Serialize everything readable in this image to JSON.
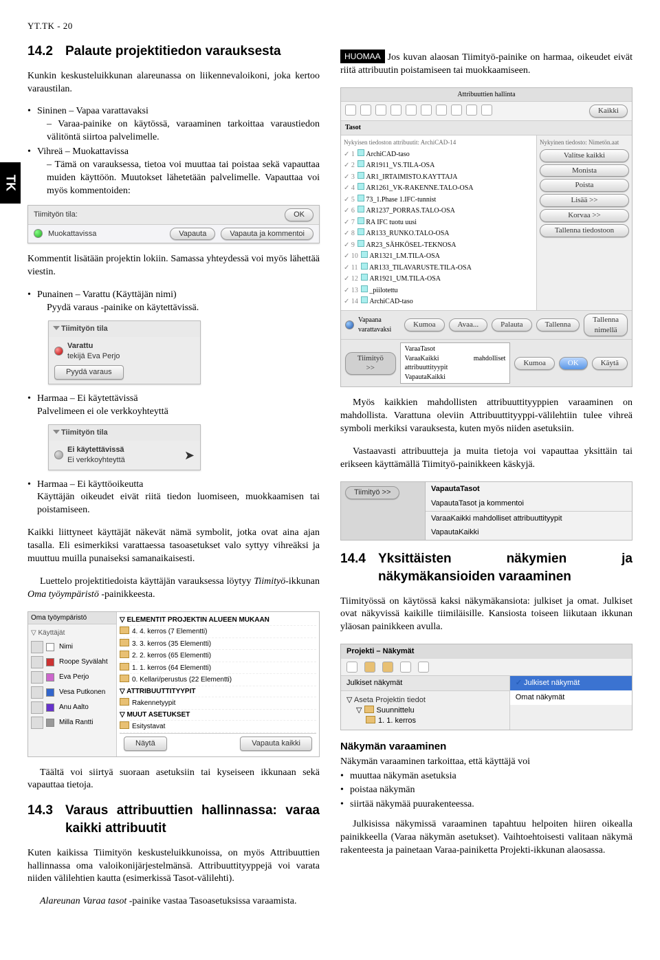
{
  "header": "YT.TK - 20",
  "side_tab": "TK",
  "s14_2": {
    "num": "14.2",
    "title": "Palaute projektitiedon varauksesta",
    "intro": "Kunkin keskusteluikkunan alareunassa on liikennevaloikoni, joka kertoo varaustilan.",
    "blue_t": "Sininen – Vapaa varattavaksi",
    "blue_d": "– Varaa-painike on käytössä, varaaminen tarkoittaa varaustiedon välitöntä siirtoa palvelimelle.",
    "green_t": "Vihreä – Muokattavissa",
    "green_d": "– Tämä on varauksessa, tietoa voi muuttaa tai poistaa sekä vapauttaa muiden käyttöön. Muutokset lähetetään palvelimelle. Vapauttaa voi myös kommentoiden:"
  },
  "shot1": {
    "label": "Tiimityön tila:",
    "status": "Muokattavissa",
    "ok": "OK",
    "rel": "Vapauta",
    "relc": "Vapauta ja kommentoi"
  },
  "after1": "Kommentit lisätään projektin lokiin. Samassa yhteydessä voi myös lähettää viestin.",
  "red_t": "Punainen – Varattu (Käyttäjän nimi)",
  "red_d": "Pyydä varaus -painike on käytettävissä.",
  "shot2": {
    "title": "Tiimityön tila",
    "l1": "Varattu",
    "l2": "tekijä Eva Perjo",
    "btn": "Pyydä varaus"
  },
  "grey1_t": "Harmaa – Ei käytettävissä",
  "grey1_d": "Palvelimeen ei ole verkkoyhteyttä",
  "shot3": {
    "title": "Tiimityön tila",
    "l1": "Ei käytettävissä",
    "l2": "Ei verkkoyhteyttä"
  },
  "grey2_t": "Harmaa – Ei käyttöoikeutta",
  "grey2_d": "Käyttäjän oikeudet eivät riitä tiedon luomiseen, muokkaamisen tai poistamiseen.",
  "p_sym": "Kaikki liittyneet käyttäjät näkevät nämä symbolit, jotka ovat aina ajan tasalla. Eli esimerkiksi varattaessa tasoasetukset valo syttyy vihreäksi ja muuttuu muilla punaiseksi samanaikaisesti.",
  "p_luettelo1": "Luettelo projektitiedoista käyttäjän varauksessa löytyy ",
  "p_luettelo_it1": "Tiimityö",
  "p_luettelo2": "-ikkunan ",
  "p_luettelo_it2": "Oma työympäristö",
  "p_luettelo3": " -painikkeesta.",
  "tree": {
    "head": "Oma työympäristö",
    "users_h": "Käyttäjät",
    "u": [
      "Nimi",
      "Roope Syvälaht",
      "Eva Perjo",
      "Vesa Putkonen",
      "Anu Aalto",
      "Milla Rantti"
    ],
    "th": "ELEMENTIT PROJEKTIN ALUEEN MUKAAN",
    "rows": [
      "4. 4. kerros (7 Elementti)",
      "3. 3. kerros (35 Elementti)",
      "2. 2. kerros (65 Elementti)",
      "1. 1. kerros (64 Elementti)",
      "0. Kellari/perustus (22 Elementti)"
    ],
    "th2": "ATTRIBUUTTITYYPIT",
    "r2": "Rakennetyypit",
    "th3": "MUUT ASETUKSET",
    "r3": "Esitystavat",
    "btn_l": "Näytä",
    "btn_r": "Vapauta kaikki"
  },
  "p_taalta": "Täältä voi siirtyä suoraan asetuksiin tai kyseiseen ikkunaan sekä vapauttaa tietoja.",
  "s14_3": {
    "num": "14.3",
    "title": "Varaus attribuuttien hallinnassa: varaa kaikki attribuutit",
    "p1": "Kuten kaikissa Tiimityön keskusteluikkunoissa, on myös Attribuuttien hallinnassa oma valoikonijärjestelmänsä. Attribuuttityyppejä voi varata niiden välilehtien kautta (esimerkissä Tasot-välilehti).",
    "p2a": "Alareunan Varaa tasot",
    "p2b": " -painike vastaa Tasoasetuksissa varaamista."
  },
  "right": {
    "note_label": "HUOMAA",
    "note": "Jos kuvan alaosan Tiimityö-painike on harmaa, oikeudet eivät riitä attribuutin poistamiseen tai muokkaamiseen.",
    "attr": {
      "title": "Attribuuttien hallinta",
      "tab": "Tasot",
      "left_h": "Nykyisen tiedoston attribuutit: ArchiCAD-14",
      "right_h": "Nykyinen tiedosto: Nimetön.aat",
      "rows": [
        "ArchiCAD-taso",
        "AR1911_VS.TILA-OSA",
        "AR1_IRTAIMISTO.KAYTTAJA",
        "AR1261_VK-RAKENNE.TALO-OSA",
        "73_1.Phase 1.IFC-tunnist",
        "AR1237_PORRAS.TALO-OSA",
        "RA IFC tuotu uusi",
        "AR133_RUNKO.TALO-OSA",
        "AR23_SÄHKÖSEL-TEKNOSA",
        "AR1321_LM.TILA-OSA",
        "AR133_TILAVARUSTE.TILA-OSA",
        "AR1921_UM.TILA-OSA",
        "_piilotettu",
        "ArchiCAD-taso"
      ],
      "btns": [
        "Valitse kaikki",
        "Monista",
        "Poista",
        "Lisää >>",
        "Korvaa >>",
        "Tallenna tiedostoon"
      ],
      "foot_left": "Vapaana varattavaksi",
      "btns2": [
        "Kumoa",
        "Avaa...",
        "Palauta",
        "Tallenna",
        "Tallenna nimellä"
      ],
      "team": "Tiimityö >>",
      "menu": [
        "VaraaTasot",
        "VaraaKaikki mahdolliset attribuuttityypit",
        "VapautaKaikki"
      ],
      "ok": "OK",
      "cancel": "Kumoa",
      "apply": "Käytä"
    },
    "p_myos": "Myös kaikkien mahdollisten attribuuttityyppien varaaminen on mahdollista. Varattuna oleviin Attribuuttityyppi-välilehtiin tulee vihreä symboli merkiksi varauksesta, kuten myös niiden asetuksiin.",
    "p_vast": "Vastaavasti attribuutteja ja muita tietoja voi vapauttaa yksittäin tai erikseen käyttämällä Tiimityö-painikkeen käskyjä.",
    "menu2": {
      "team": "Tiimityö >>",
      "items": [
        "VapautaTasot",
        "VapautaTasot ja kommentoi",
        "VaraaKaikki mahdolliset attribuuttityypit",
        "VapautaKaikki"
      ]
    }
  },
  "s14_4": {
    "num": "14.4",
    "title": "Yksittäisten näkymien ja näkymäkansioiden varaaminen",
    "p1": "Tiimityössä on käytössä kaksi näkymäkansiota: julkiset ja omat. Julkiset ovat näkyvissä kaikille tiimiläisille. Kansiosta toiseen liikutaan ikkunan yläosan painikkeen avulla.",
    "proj": {
      "title": "Projekti – Näkymät",
      "tab": "Julkiset näkymät",
      "sel": "Julkiset näkymät",
      "opt2": "Omat näkymät",
      "r1": "Aseta Projektin tiedot",
      "r2": "Suunnittelu",
      "r3": "1. 1. kerros"
    },
    "sub": "Näkymän varaaminen",
    "p2": "Näkymän varaaminen tarkoittaa, että käyttäjä voi",
    "bul": [
      "muuttaa näkymän asetuksia",
      "poistaa näkymän",
      "siirtää näkymää puurakenteessa."
    ],
    "p3": "Julkisissa näkymissä varaaminen tapahtuu helpoiten hiiren oikealla painikkeella (Varaa näkymän asetukset). Vaihtoehtoisesti valitaan näkymä rakenteesta ja painetaan Varaa-painiketta Projekti-ikkunan alaosassa."
  }
}
